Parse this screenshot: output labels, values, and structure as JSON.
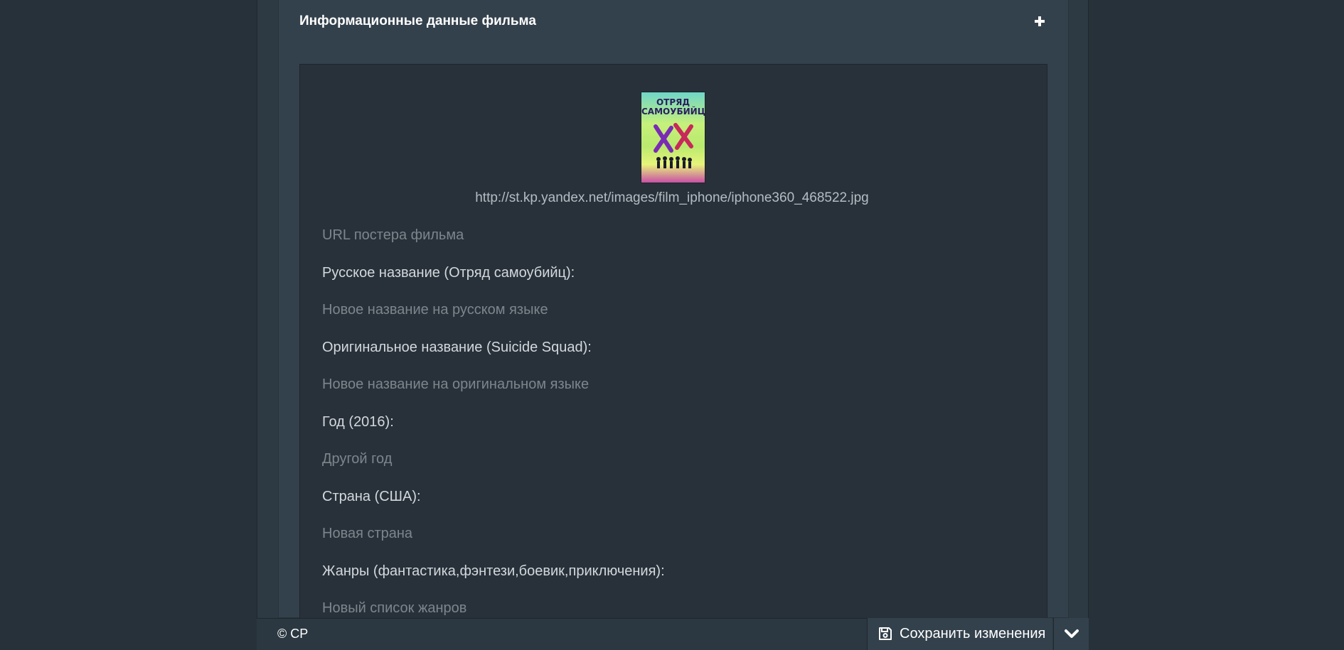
{
  "panel": {
    "title": "Информационные данные фильма",
    "toggle_icon": "plus-icon"
  },
  "poster": {
    "image_title": "ОТРЯД САМОУБИЙЦ",
    "url": "http://st.kp.yandex.net/images/film_iphone/iphone360_468522.jpg",
    "url_placeholder": "URL постера фильма"
  },
  "fields": {
    "russian_title_label": "Русское название (Отряд самоубийц):",
    "russian_title_placeholder": "Новое название на русском языке",
    "original_title_label": "Оригинальное название (Suicide Squad):",
    "original_title_placeholder": "Новое название на оригинальном языке",
    "year_label": "Год (2016):",
    "year_placeholder": "Другой год",
    "country_label": "Страна (США):",
    "country_placeholder": "Новая страна",
    "genres_label": "Жанры (фантастика,фэнтези,боевик,приключения):",
    "genres_placeholder": "Новый список жанров"
  },
  "footer": {
    "copyright": "© CP",
    "save_label": "Сохранить изменения",
    "save_icon": "floppy-disk-icon",
    "dropdown_icon": "chevron-down-icon"
  },
  "colors": {
    "background": "#27313a",
    "panel": "#33414c",
    "inner": "#28313a",
    "text": "#ffffff",
    "placeholder": "#7d858c"
  }
}
